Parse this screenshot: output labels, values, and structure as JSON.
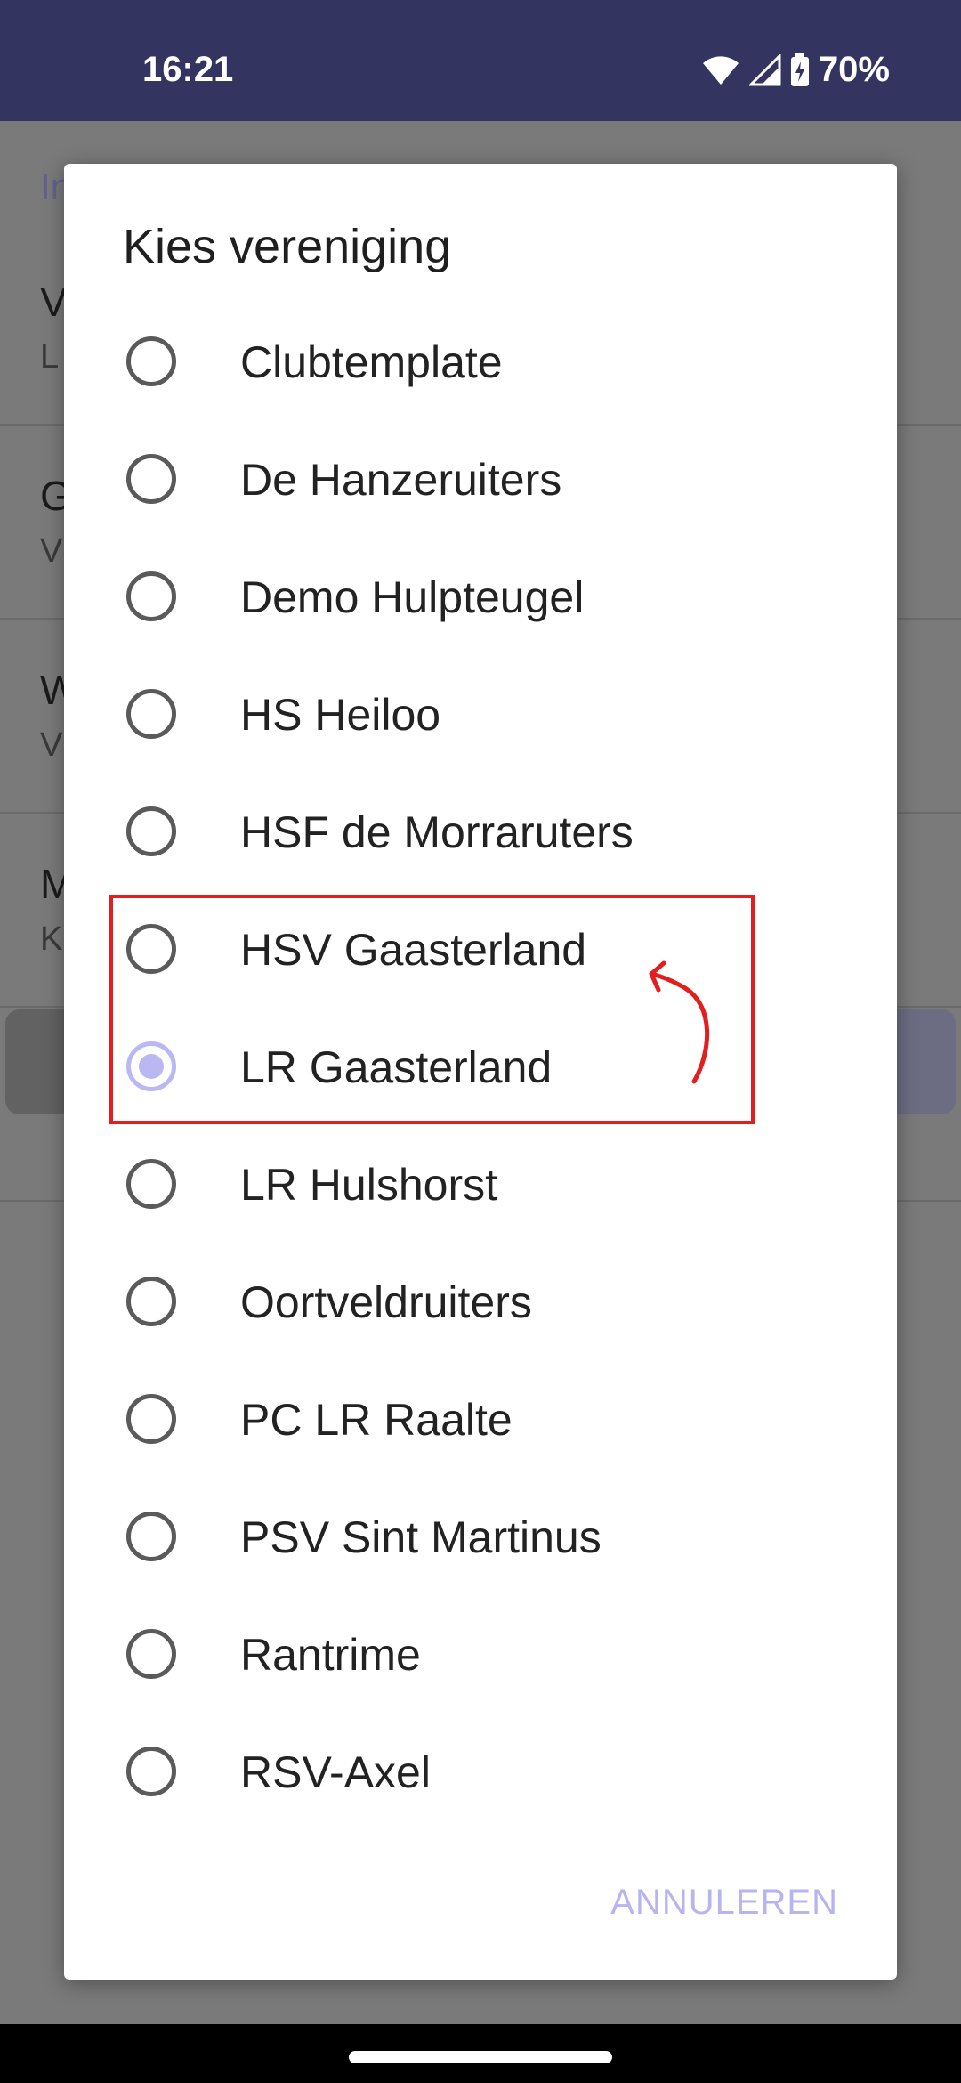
{
  "status_bar": {
    "time": "16:21",
    "battery": "70%"
  },
  "background": {
    "section_label": "In",
    "rows": [
      {
        "title": "V",
        "subtitle": "L"
      },
      {
        "title": "G",
        "subtitle": "V"
      },
      {
        "title": "W",
        "subtitle": "V"
      },
      {
        "title": "M",
        "subtitle": "K"
      }
    ]
  },
  "dialog": {
    "title": "Kies vereniging",
    "options": [
      {
        "label": "Clubtemplate",
        "checked": false
      },
      {
        "label": "De Hanzeruiters",
        "checked": false
      },
      {
        "label": "Demo Hulpteugel",
        "checked": false
      },
      {
        "label": "HS Heiloo",
        "checked": false
      },
      {
        "label": "HSF de Morraruters",
        "checked": false
      },
      {
        "label": "HSV Gaasterland",
        "checked": false
      },
      {
        "label": "LR Gaasterland",
        "checked": true
      },
      {
        "label": "LR Hulshorst",
        "checked": false
      },
      {
        "label": "Oortveldruiters",
        "checked": false
      },
      {
        "label": "PC LR Raalte",
        "checked": false
      },
      {
        "label": "PSV Sint Martinus",
        "checked": false
      },
      {
        "label": "Rantrime",
        "checked": false
      },
      {
        "label": "RSV-Axel",
        "checked": false
      }
    ],
    "cancel_label": "ANNULEREN"
  },
  "colors": {
    "status_bar": "#343461",
    "accent": "#b9b8f3",
    "annotation": "#e31e1e"
  }
}
